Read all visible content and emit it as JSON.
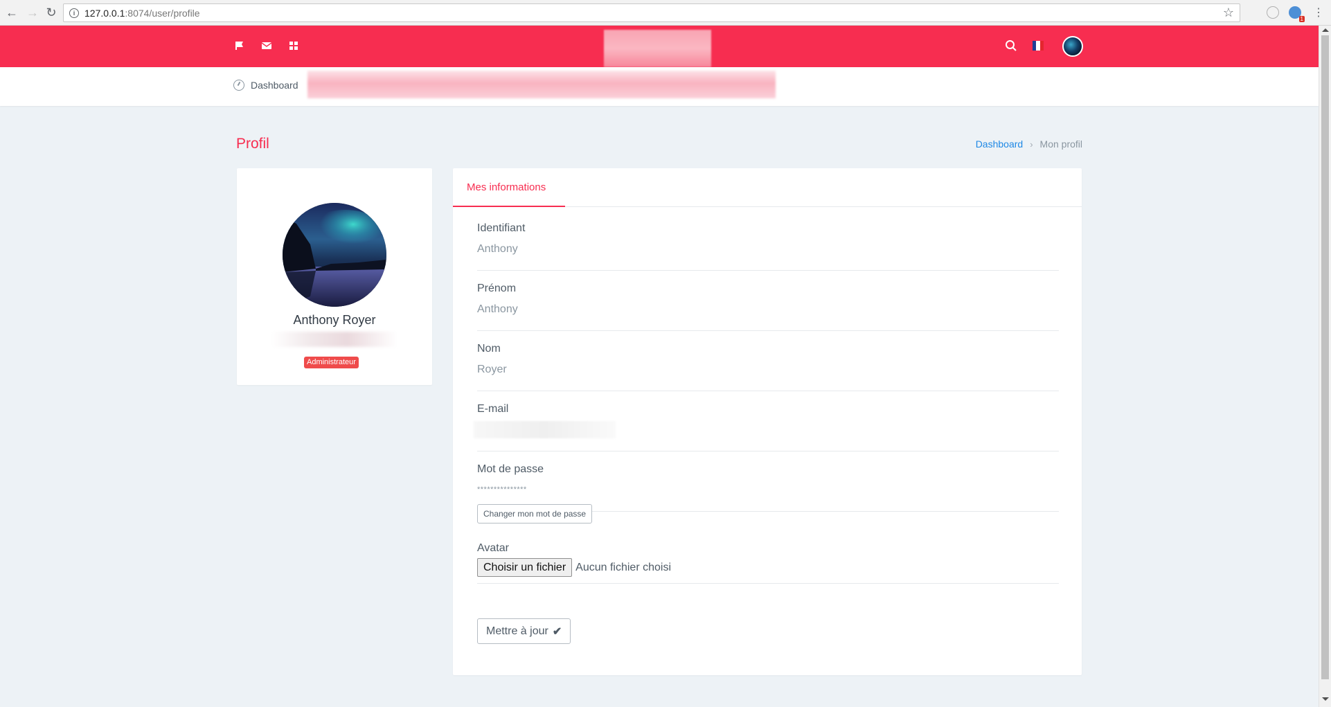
{
  "browser": {
    "url_host": "127.0.0.1",
    "url_path": ":8074/user/profile",
    "ext_badge": "1"
  },
  "topbar": {
    "color": "#f72d50",
    "icons": [
      "flag-icon",
      "mail-icon",
      "grid-icon",
      "search-icon"
    ],
    "flag": "fr"
  },
  "subnav": {
    "dashboard_label": "Dashboard"
  },
  "page": {
    "title": "Profil",
    "breadcrumb": {
      "link": "Dashboard",
      "current": "Mon profil"
    }
  },
  "profile": {
    "name": "Anthony Royer",
    "role": "Administrateur"
  },
  "info": {
    "tab_label": "Mes informations",
    "fields": {
      "identifiant": {
        "label": "Identifiant",
        "value": "Anthony"
      },
      "prenom": {
        "label": "Prénom",
        "value": "Anthony"
      },
      "nom": {
        "label": "Nom",
        "value": "Royer"
      },
      "email": {
        "label": "E-mail"
      },
      "password": {
        "label": "Mot de passe",
        "value": "***************"
      }
    },
    "change_password_label": "Changer mon mot de passe",
    "avatar": {
      "label": "Avatar",
      "file_button": "Choisir un fichier",
      "file_status": "Aucun fichier choisi"
    },
    "update_label": "Mettre à jour",
    "update_icon": "✔"
  }
}
